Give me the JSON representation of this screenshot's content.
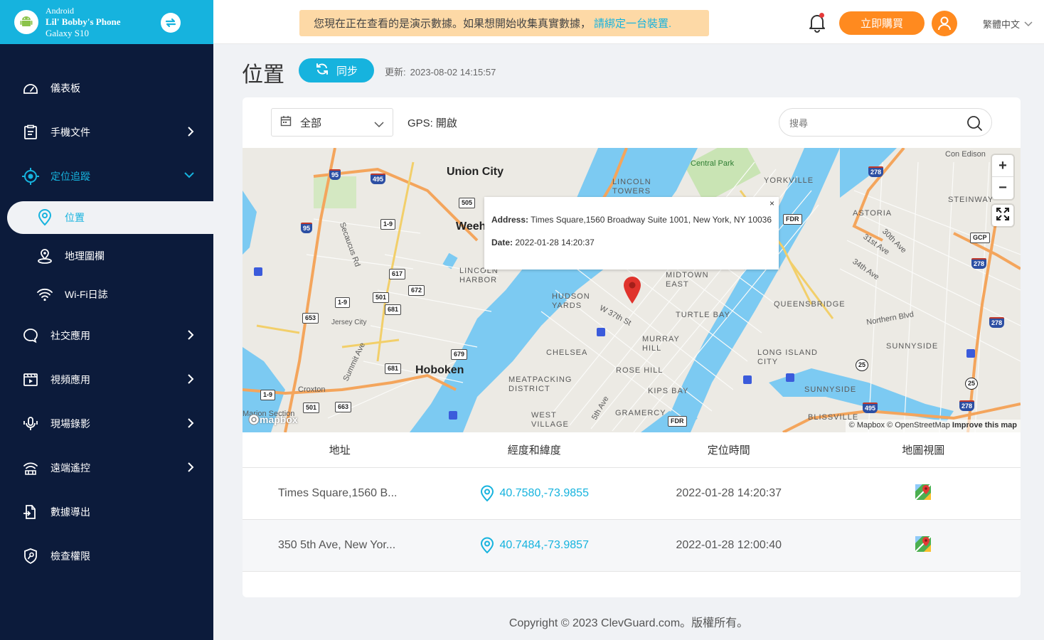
{
  "device": {
    "os": "Android",
    "name": "Lil' Bobby's Phone",
    "model": "Galaxy S10"
  },
  "sidebar": {
    "items": [
      {
        "label": "儀表板",
        "icon": "dashboard-icon"
      },
      {
        "label": "手機文件",
        "icon": "document-icon"
      },
      {
        "label": "定位追蹤",
        "icon": "location-target-icon"
      },
      {
        "label": "社交應用",
        "icon": "chat-bubble-icon"
      },
      {
        "label": "視頻應用",
        "icon": "video-icon"
      },
      {
        "label": "現場錄影",
        "icon": "microphone-icon"
      },
      {
        "label": "遠端遙控",
        "icon": "remote-control-icon"
      },
      {
        "label": "數據導出",
        "icon": "export-icon"
      },
      {
        "label": "檢查權限",
        "icon": "shield-icon"
      }
    ],
    "sub_items": [
      {
        "label": "位置",
        "icon": "map-pin-icon"
      },
      {
        "label": "地理圍欄",
        "icon": "geofence-icon"
      },
      {
        "label": "Wi-Fi日誌",
        "icon": "wifi-icon"
      }
    ]
  },
  "topbar": {
    "banner_text": "您現在正在查看的是演示數據。如果想開始收集真實數據，",
    "banner_link": "請綁定一台裝置.",
    "buy_label": "立即購買",
    "language": "繁體中文"
  },
  "page": {
    "title": "位置",
    "sync_label": "同步",
    "updated_label": "更新:",
    "updated_value": "2023-08-02 14:15:57"
  },
  "filter": {
    "selected": "全部",
    "gps_label": "GPS:",
    "gps_value": "開啟",
    "search_placeholder": "搜尋"
  },
  "map": {
    "popup_address_label": "Address:",
    "popup_address": "Times Square,1560 Broadway Suite 1001, New York, NY 10036",
    "popup_date_label": "Date:",
    "popup_date": "2022-01-28 14:20:37",
    "popup_close": "×",
    "zoom_in": "+",
    "zoom_out": "−",
    "logo": "mapbox",
    "attribution_mapbox": "© Mapbox",
    "attribution_osm": "© OpenStreetMap",
    "attribution_improve": "Improve this map",
    "labels": {
      "union_city": "Union City",
      "hoboken": "Hoboken",
      "weehawken": "Weeh",
      "central_park": "Central Park",
      "yorkville": "YORKVILLE",
      "lincoln_towers": "LINCOLN TOWERS",
      "astoria": "ASTORIA",
      "steinway": "STEINWAY",
      "midtown_east": "MIDTOWN EAST",
      "hudson_yards": "HUDSON YARDS",
      "turtle_bay": "TURTLE BAY",
      "murray_hill": "MURRAY HILL",
      "chelsea": "CHELSEA",
      "rose_hill": "ROSE HILL",
      "kips_bay": "KIPS BAY",
      "gramercy": "GRAMERCY",
      "meatpacking": "MEATPACKING DISTRICT",
      "west_village": "WEST VILLAGE",
      "queensbridge": "QUEENSBRIDGE",
      "long_island_city": "LONG ISLAND CITY",
      "sunnyside": "SUNNYSIDE",
      "sunnyside2": "SUNNYSIDE",
      "blissville": "BLISSVILLE",
      "lincoln_harbor": "LINCOLN HARBOR",
      "jersey_city": "Jersey City",
      "croxton": "Croxton",
      "marion_section": "Marion Section",
      "con_edison": "Con Edison",
      "w37": "W 37th St",
      "northern_blvd": "Northern Blvd",
      "secaucus_rd": "Secaucus Rd",
      "summit_ave": "Summit Ave",
      "fifth_ave": "5th Ave",
      "thirty_fourth": "34th Ave",
      "thirty_first": "31st Ave",
      "thirtieth": "30th Ave"
    },
    "shields": [
      "95",
      "495",
      "505",
      "1-9",
      "95",
      "617",
      "672",
      "501",
      "681",
      "1-9",
      "653",
      "679",
      "681",
      "663",
      "501",
      "1-9",
      "278",
      "278",
      "278",
      "FDR",
      "GCP",
      "25",
      "25",
      "495",
      "278",
      "FDR"
    ]
  },
  "table": {
    "headers": [
      "地址",
      "經度和緯度",
      "定位時間",
      "地圖視圖"
    ],
    "rows": [
      {
        "address": "Times Square,1560 B...",
        "coords": "40.7580,-73.9855",
        "time": "2022-01-28 14:20:37",
        "map_icon": "google-maps-icon"
      },
      {
        "address": "350 5th Ave, New Yor...",
        "coords": "40.7484,-73.9857",
        "time": "2022-01-28 12:00:40",
        "map_icon": "google-maps-icon"
      }
    ]
  },
  "footer": {
    "copyright": "Copyright © 2023 ClevGuard.com。版權所有。"
  },
  "colors": {
    "accent": "#16b3de",
    "sidebar_bg": "#0c1b3b",
    "buy_orange": "#ff8a1f",
    "banner_bg": "#fdd9a6",
    "water": "#7ccaf2",
    "pin_red": "#e0332c"
  }
}
